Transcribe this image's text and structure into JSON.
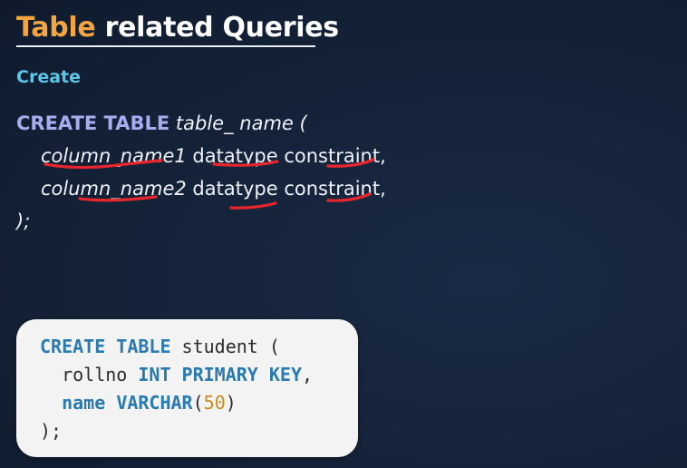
{
  "title": {
    "accent": "Table",
    "rest": " related Queries"
  },
  "section": {
    "label": "Create"
  },
  "syntax": {
    "line1": {
      "keyword": "CREATE TABLE",
      "name": "table_ name (",
      "name_sep": " "
    },
    "line2": {
      "column": "column_name1",
      "datatype": "datatype",
      "constraint": "constraint,"
    },
    "line3": {
      "column": "column_name2",
      "datatype": "datatype",
      "constraint": "constraint,"
    },
    "line4": {
      "closing": ");"
    },
    "annotation_color": "#e8262d"
  },
  "example": {
    "line1": {
      "keyword": "CREATE TABLE",
      "text": " student ("
    },
    "line2": {
      "indent": "  ",
      "column": "rollno",
      "type": "INT PRIMARY KEY",
      "punct": ","
    },
    "line3": {
      "indent": "  ",
      "column": "name",
      "type": "VARCHAR",
      "open": "(",
      "size": "50",
      "close": ")"
    },
    "line4": {
      "closing": ");"
    }
  }
}
